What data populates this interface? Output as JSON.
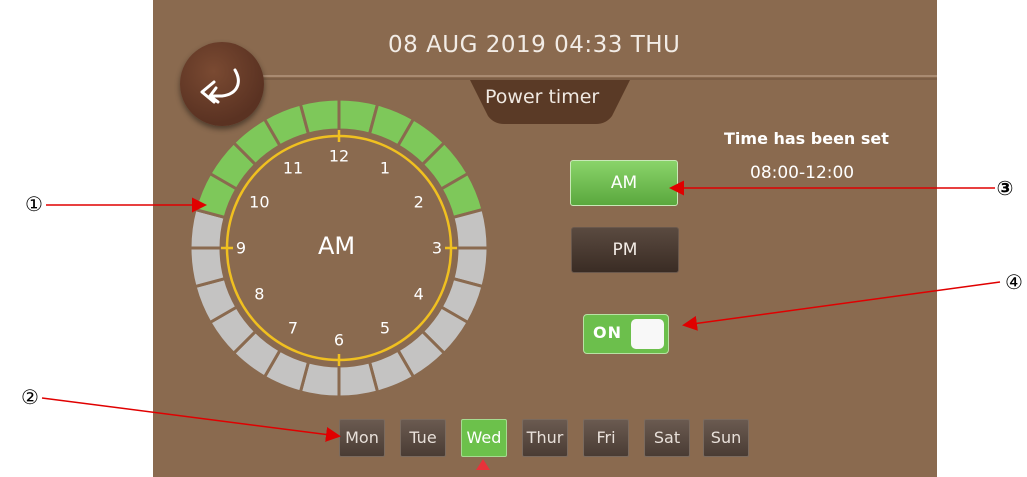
{
  "header": {
    "datetime": "08 AUG 2019 04:33 THU",
    "page_tab": "Power timer"
  },
  "back_button": {
    "icon": "back-arrow-icon"
  },
  "clock": {
    "center_label": "AM",
    "hour_numbers": [
      "12",
      "1",
      "2",
      "3",
      "4",
      "5",
      "6",
      "7",
      "8",
      "9",
      "10",
      "11"
    ],
    "segments_on": [
      1,
      1,
      1,
      1,
      1,
      0,
      0,
      0,
      0,
      0,
      0,
      0,
      0,
      0,
      0,
      0,
      0,
      0,
      0,
      1,
      1,
      1,
      1,
      1
    ],
    "color_on": "#7ec85a",
    "color_off": "#c4c3c2"
  },
  "status": {
    "title": "Time has been set",
    "value": "08:00-12:00"
  },
  "period": {
    "am_label": "AM",
    "pm_label": "PM",
    "selected": "AM"
  },
  "power_toggle": {
    "label": "ON",
    "state": "on"
  },
  "days": [
    {
      "label": "Mon",
      "active": false
    },
    {
      "label": "Tue",
      "active": false
    },
    {
      "label": "Wed",
      "active": true
    },
    {
      "label": "Thur",
      "active": false
    },
    {
      "label": "Fri",
      "active": false
    },
    {
      "label": "Sat",
      "active": false
    },
    {
      "label": "Sun",
      "active": false
    }
  ],
  "callouts": [
    "①",
    "②",
    "③",
    "④"
  ],
  "colors": {
    "background": "#8a6a4f",
    "accent_green": "#6cc14b",
    "dial_yellow": "#f0c020",
    "annotation_red": "#e00000"
  }
}
